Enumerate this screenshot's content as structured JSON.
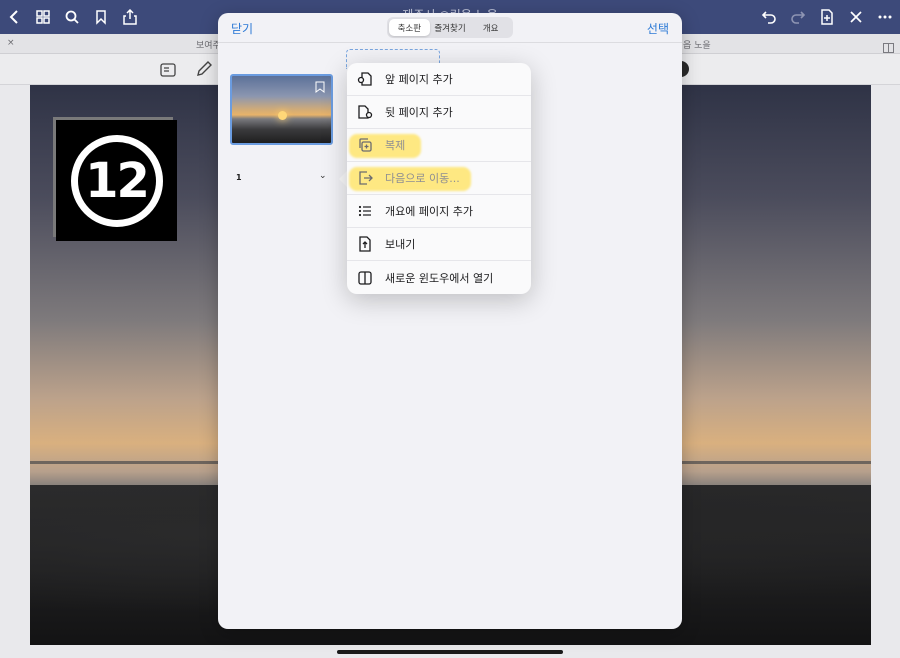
{
  "top_bar": {
    "title": "제주시 ○림읍 노을",
    "icons": [
      "back-icon",
      "grid-icon",
      "search-icon",
      "bookmark-icon",
      "share-icon",
      "undo-icon",
      "redo-icon",
      "new-page-icon",
      "close-icon",
      "more-icon"
    ]
  },
  "tab_strip": {
    "close_glyph": "×",
    "left_tab": "보여주",
    "right_tab": "읍 노을"
  },
  "step_badge": {
    "number": "12"
  },
  "panel": {
    "close_label": "닫기",
    "select_label": "선택",
    "segments": [
      "축소판",
      "즐겨찾기",
      "개요"
    ],
    "active_segment": "축소판",
    "thumbnail": {
      "page_number": "1",
      "chevron": "⌄"
    }
  },
  "context_menu": {
    "items": [
      {
        "label": "앞 페이지 추가",
        "icon": "page-add-before-icon"
      },
      {
        "label": "뒷 페이지 추가",
        "icon": "page-add-after-icon"
      },
      {
        "label": "복제",
        "icon": "duplicate-icon",
        "highlighted": true
      },
      {
        "label": "다음으로 이동...",
        "icon": "move-to-icon",
        "highlighted": true
      },
      {
        "label": "개요에 페이지 추가",
        "icon": "outline-list-icon"
      },
      {
        "label": "보내기",
        "icon": "export-icon"
      },
      {
        "label": "새로운 윈도우에서 열기",
        "icon": "new-window-icon"
      }
    ]
  },
  "colors": {
    "accent": "#2d7ad6",
    "top_bar": "#3d4a7a",
    "highlight": "#ffe25a"
  }
}
